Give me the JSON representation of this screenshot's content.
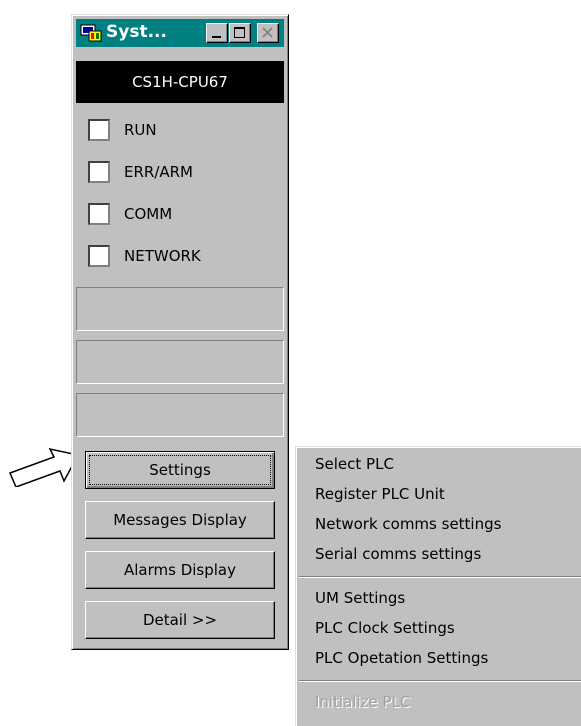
{
  "window": {
    "title": "Syst...",
    "model": "CS1H-CPU67"
  },
  "indicators": [
    {
      "label": "RUN"
    },
    {
      "label": "ERR/ARM"
    },
    {
      "label": "COMM"
    },
    {
      "label": "NETWORK"
    }
  ],
  "buttons": {
    "settings": "Settings",
    "messages": "Messages Display",
    "alarms": "Alarms Display",
    "detail": "Detail >>"
  },
  "menu": {
    "items": [
      {
        "label": "Select PLC"
      },
      {
        "label": "Register PLC Unit"
      },
      {
        "label": "Network comms settings"
      },
      {
        "label": "Serial comms settings"
      },
      {
        "label": "UM Settings"
      },
      {
        "label": "PLC Clock Settings"
      },
      {
        "label": "PLC Opetation Settings"
      },
      {
        "label": "Initialize PLC",
        "disabled": true
      }
    ]
  },
  "icons": {
    "app": "plc-app-icon",
    "minimize": "minimize-icon",
    "maximize": "maximize-icon",
    "close": "close-icon",
    "pointer": "right-arrow-icon"
  },
  "colors": {
    "title_bar": "#008080",
    "face": "#c0c0c0",
    "disabled_text": "#a0a0a0"
  }
}
